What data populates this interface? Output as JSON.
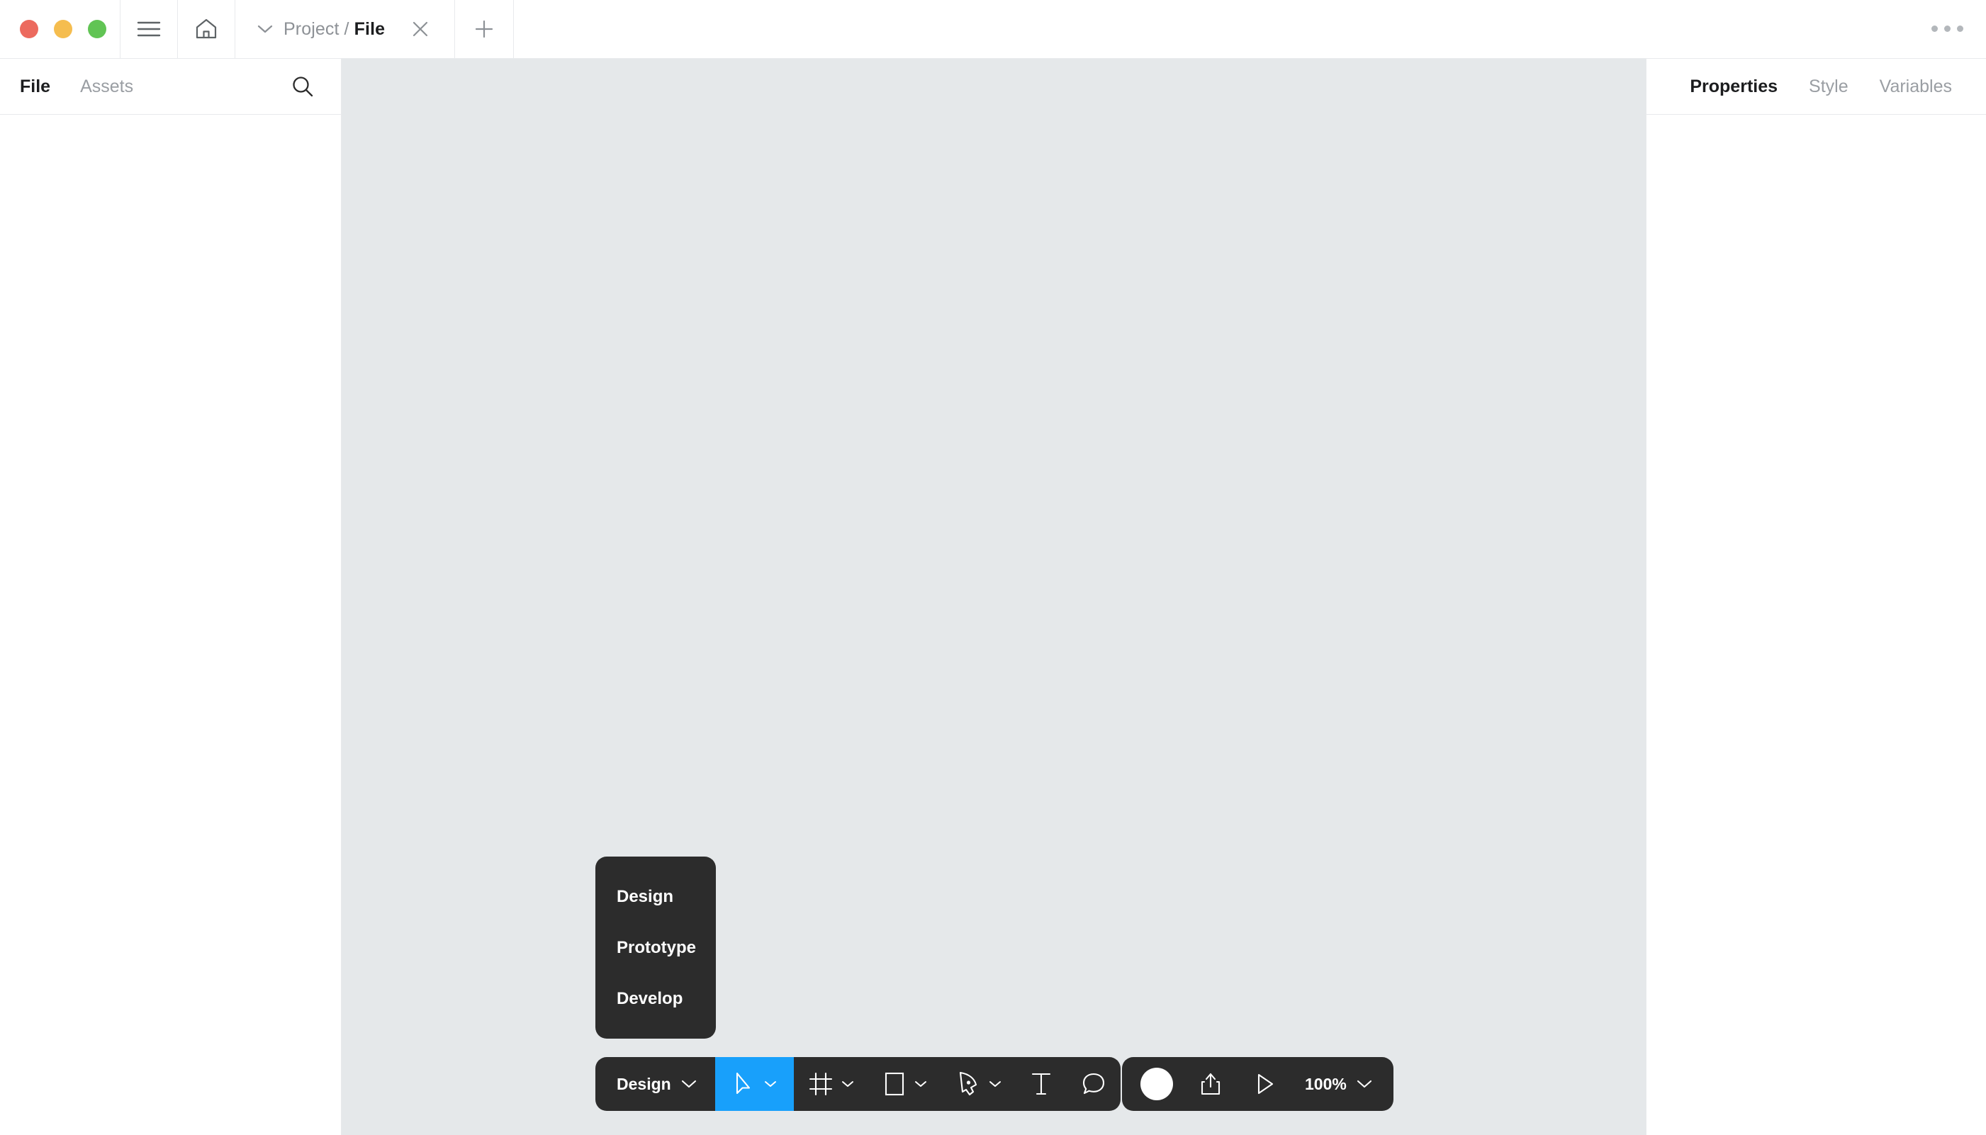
{
  "window": {
    "traffic_lights": [
      {
        "name": "close",
        "color": "#ec6a5e"
      },
      {
        "name": "minimize",
        "color": "#f5bd4f"
      },
      {
        "name": "maximize",
        "color": "#61c454"
      }
    ],
    "menu_icon": "hamburger-menu-icon",
    "home_icon": "home-icon",
    "more_icon": "more-options-icon"
  },
  "tab": {
    "chevron_icon": "chevron-down-icon",
    "project_label": "Project /",
    "file_label": "File",
    "close_icon": "close-icon",
    "new_tab_icon": "plus-icon"
  },
  "left_panel": {
    "tabs": [
      {
        "label": "File",
        "active": true
      },
      {
        "label": "Assets",
        "active": false
      }
    ],
    "search_icon": "search-icon"
  },
  "right_panel": {
    "tabs": [
      {
        "label": "Properties",
        "active": true
      },
      {
        "label": "Style",
        "active": false
      },
      {
        "label": "Variables",
        "active": false
      }
    ]
  },
  "mode_menu": {
    "items": [
      {
        "label": "Design"
      },
      {
        "label": "Prototype"
      },
      {
        "label": "Develop"
      }
    ]
  },
  "toolbar": {
    "mode_label": "Design",
    "mode_chevron_icon": "chevron-down-icon",
    "tools": [
      {
        "name": "move-tool",
        "icon": "cursor-arrow-icon",
        "active": true,
        "has_chevron": true
      },
      {
        "name": "frame-tool",
        "icon": "frame-icon",
        "active": false,
        "has_chevron": true
      },
      {
        "name": "shape-tool",
        "icon": "square-icon",
        "active": false,
        "has_chevron": true
      },
      {
        "name": "pen-tool",
        "icon": "pen-icon",
        "active": false,
        "has_chevron": true
      },
      {
        "name": "text-tool",
        "icon": "text-icon",
        "active": false,
        "has_chevron": false
      },
      {
        "name": "comment-tool",
        "icon": "comment-bubble-icon",
        "active": false,
        "has_chevron": false
      }
    ],
    "accent_color": "#18a0fb",
    "bar_color": "#2c2c2c"
  },
  "toolbar_right": {
    "avatar_icon": "avatar",
    "share_icon": "share-export-icon",
    "present_icon": "play-present-icon",
    "zoom_label": "100%",
    "zoom_chevron_icon": "chevron-down-icon"
  },
  "canvas": {
    "background_color": "#e5e8ea"
  }
}
